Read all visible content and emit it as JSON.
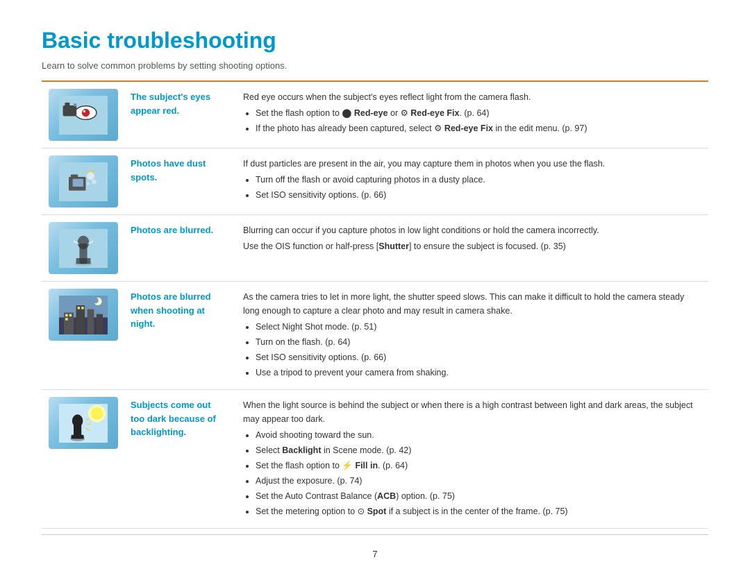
{
  "page": {
    "title": "Basic troubleshooting",
    "subtitle": "Learn to solve common problems by setting shooting options.",
    "page_number": "7"
  },
  "rows": [
    {
      "id": "red-eye",
      "label_line1": "The subject's eyes",
      "label_line2": "appear red.",
      "description_intro": "Red eye occurs when the subject's eyes reflect light from the camera flash.",
      "bullets": [
        {
          "text": "Set the flash option to 🔴 Red-eye or 🔧 Red-eye Fix. (p. 64)"
        },
        {
          "text": "If the photo has already been captured, select 🔧 Red-eye Fix in the edit menu. (p. 97)"
        }
      ]
    },
    {
      "id": "dust",
      "label_line1": "Photos have dust",
      "label_line2": "spots.",
      "description_intro": "If dust particles are present in the air, you may capture them in photos when you use the flash.",
      "bullets": [
        {
          "text": "Turn off the flash or avoid capturing photos in a dusty place."
        },
        {
          "text": "Set ISO sensitivity options. (p. 66)"
        }
      ]
    },
    {
      "id": "blurred",
      "label_line1": "Photos are blurred.",
      "label_line2": "",
      "description_intro": "Blurring can occur if you capture photos in low light conditions or hold the camera incorrectly.",
      "description_extra": "Use the OIS function or half-press [Shutter] to ensure the subject is focused. (p. 35)",
      "bullets": []
    },
    {
      "id": "night",
      "label_line1": "Photos are blurred",
      "label_line2": "when shooting at",
      "label_line3": "night.",
      "description_intro": "As the camera tries to let in more light, the shutter speed slows. This can make it difficult to hold the camera steady long enough to capture a clear photo and may result in camera shake.",
      "bullets": [
        {
          "text": "Select Night Shot mode. (p. 51)"
        },
        {
          "text": "Turn on the flash. (p. 64)"
        },
        {
          "text": "Set ISO sensitivity options. (p. 66)"
        },
        {
          "text": "Use a tripod to prevent your camera from shaking."
        }
      ]
    },
    {
      "id": "backlight",
      "label_line1": "Subjects come out",
      "label_line2": "too dark because of",
      "label_line3": "backlighting.",
      "description_intro": "When the light source is behind the subject or when there is a high contrast between light and dark areas, the subject may appear too dark.",
      "bullets": [
        {
          "text": "Avoid shooting toward the sun."
        },
        {
          "text": "Select Backlight in Scene mode. (p. 42)",
          "bold_word": "Backlight"
        },
        {
          "text": "Set the flash option to ⚡ Fill in. (p. 64)",
          "bold_word": "Fill in"
        },
        {
          "text": "Adjust the exposure. (p. 74)"
        },
        {
          "text": "Set the Auto Contrast Balance (ACB) option. (p. 75)",
          "bold_word": "ACB"
        },
        {
          "text": "Set the metering option to ⊙ Spot if a subject is in the center of the frame. (p. 75)",
          "bold_word": "Spot"
        }
      ]
    }
  ]
}
